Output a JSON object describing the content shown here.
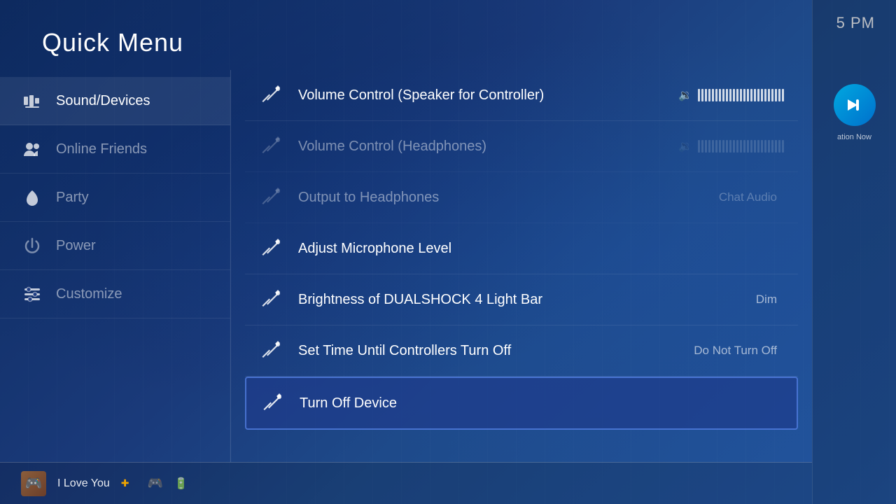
{
  "header": {
    "title": "Quick Menu",
    "time": "5 PM"
  },
  "sidebar": {
    "items": [
      {
        "id": "sound-devices",
        "label": "Sound/Devices",
        "active": true
      },
      {
        "id": "online-friends",
        "label": "Online Friends",
        "active": false
      },
      {
        "id": "party",
        "label": "Party",
        "active": false
      },
      {
        "id": "power",
        "label": "Power",
        "active": false
      },
      {
        "id": "customize",
        "label": "Customize",
        "active": false
      }
    ]
  },
  "content": {
    "items": [
      {
        "id": "volume-control-speaker",
        "label": "Volume Control (Speaker for Controller)",
        "showVolumeBar": true,
        "dimmed": false,
        "selected": false,
        "value": ""
      },
      {
        "id": "volume-control-headphones",
        "label": "Volume Control (Headphones)",
        "showVolumeBar": true,
        "dimmed": true,
        "selected": false,
        "value": ""
      },
      {
        "id": "output-to-headphones",
        "label": "Output to Headphones",
        "showVolumeBar": false,
        "dimmed": true,
        "selected": false,
        "value": "Chat Audio"
      },
      {
        "id": "adjust-microphone",
        "label": "Adjust Microphone Level",
        "showVolumeBar": false,
        "dimmed": false,
        "selected": false,
        "value": ""
      },
      {
        "id": "brightness-lightbar",
        "label": "Brightness of DUALSHOCK 4 Light Bar",
        "showVolumeBar": false,
        "dimmed": false,
        "selected": false,
        "value": "Dim"
      },
      {
        "id": "set-time-controllers",
        "label": "Set Time Until Controllers Turn Off",
        "showVolumeBar": false,
        "dimmed": false,
        "selected": false,
        "value": "Do Not Turn Off"
      },
      {
        "id": "turn-off-device",
        "label": "Turn Off Device",
        "showVolumeBar": false,
        "dimmed": false,
        "selected": true,
        "value": ""
      }
    ]
  },
  "statusBar": {
    "username": "I Love You",
    "psPlus": true
  },
  "psPanel": {
    "label": "ation Now"
  }
}
